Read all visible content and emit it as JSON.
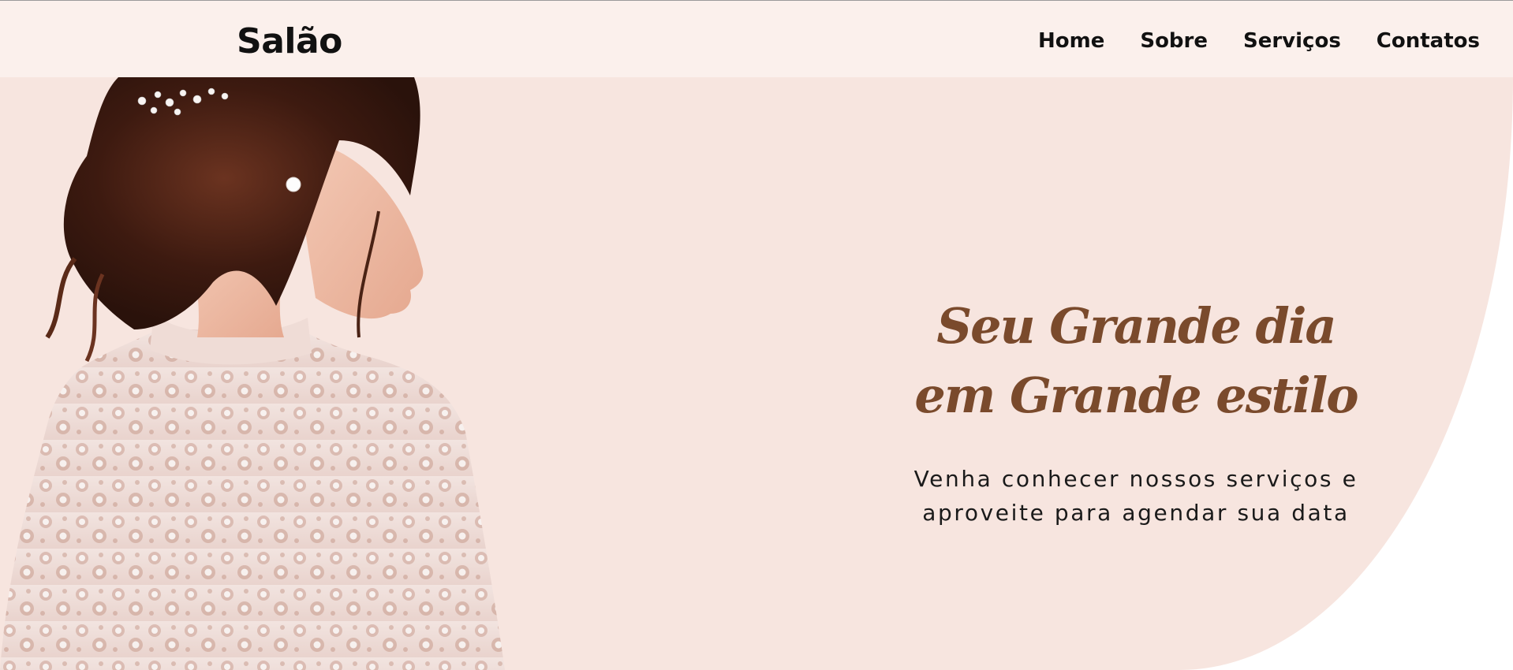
{
  "header": {
    "logo": "Salão",
    "nav": [
      {
        "label": "Home"
      },
      {
        "label": "Sobre"
      },
      {
        "label": "Serviços"
      },
      {
        "label": "Contatos"
      }
    ]
  },
  "hero": {
    "headline_line1": "Seu Grande dia",
    "headline_line2": "em Grande estilo",
    "subtitle_line1": "Venha conhecer nossos serviços e",
    "subtitle_line2": "aproveite para agendar sua data"
  },
  "colors": {
    "header_bg": "#fbf0ec",
    "hero_bg": "#f7e5df",
    "headline": "#7a4a2c",
    "text": "#111111"
  }
}
